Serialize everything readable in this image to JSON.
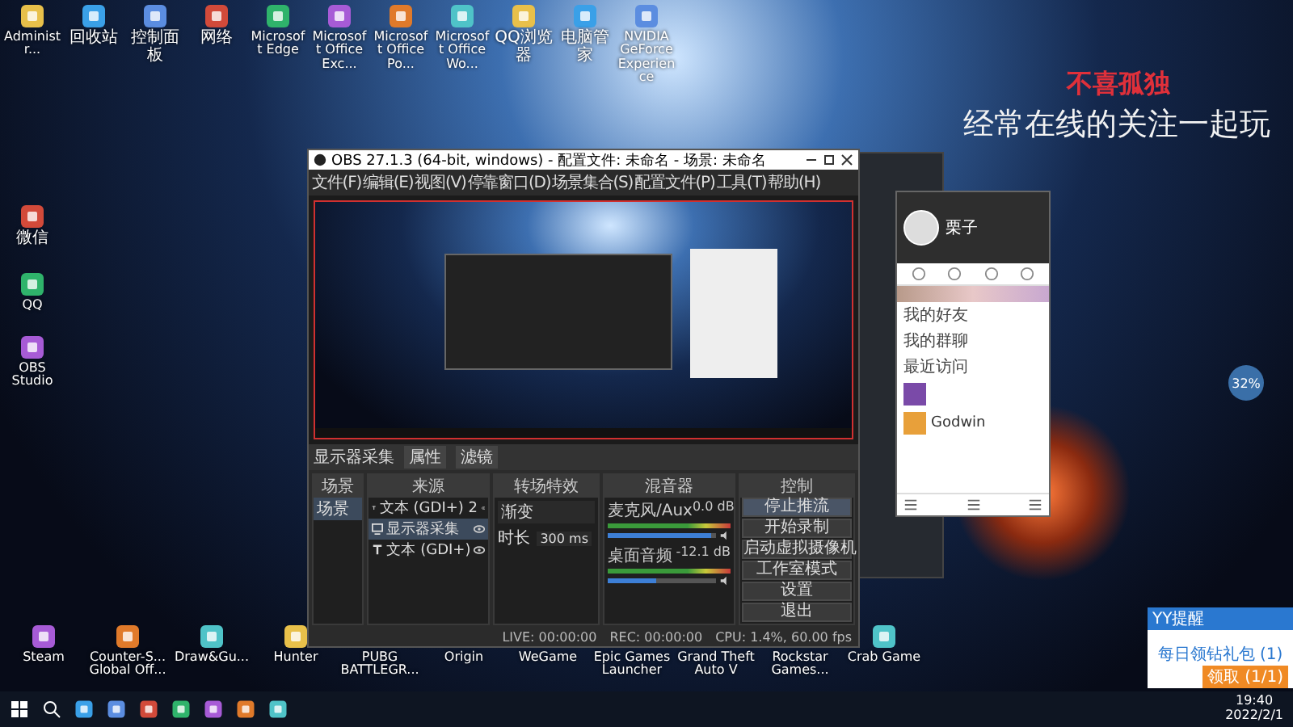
{
  "desktop": {
    "wallpaper_title": "不喜孤独",
    "wallpaper_subtitle": "经常在线的关注一起玩",
    "top_icons": [
      {
        "label": "Administr..."
      },
      {
        "label": "回收站"
      },
      {
        "label": "控制面板"
      },
      {
        "label": "网络"
      },
      {
        "label": "Microsoft Edge"
      },
      {
        "label": "Microsoft Office Exc..."
      },
      {
        "label": "Microsoft Office Po..."
      },
      {
        "label": "Microsoft Office Wo..."
      },
      {
        "label": "QQ浏览器"
      },
      {
        "label": "电脑管家"
      },
      {
        "label": "NVIDIA GeForce Experience"
      }
    ],
    "left_icons": [
      {
        "label": "微信"
      },
      {
        "label": "QQ"
      },
      {
        "label": "OBS Studio"
      }
    ],
    "bottom_icons": [
      {
        "label": "Steam"
      },
      {
        "label": "Counter-S... Global Off..."
      },
      {
        "label": "Draw&Gu..."
      },
      {
        "label": "Hunter"
      },
      {
        "label": "PUBG BATTLEGR..."
      },
      {
        "label": "Origin"
      },
      {
        "label": "WeGame"
      },
      {
        "label": "Epic Games Launcher"
      },
      {
        "label": "Grand Theft Auto V"
      },
      {
        "label": "Rockstar Games..."
      },
      {
        "label": "Crab Game"
      }
    ]
  },
  "obs": {
    "title": "OBS 27.1.3 (64-bit, windows) - 配置文件: 未命名 - 场景: 未命名",
    "menu": [
      "文件(F)",
      "编辑(E)",
      "视图(V)",
      "停靠窗口(D)",
      "场景集合(S)",
      "配置文件(P)",
      "工具(T)",
      "帮助(H)"
    ],
    "context_bar": {
      "source": "显示器采集",
      "buttons": [
        "属性",
        "滤镜"
      ]
    },
    "dock_titles": {
      "scenes": "场景",
      "sources": "来源",
      "transitions": "转场特效",
      "mixer": "混音器",
      "controls": "控制"
    },
    "scenes": [
      {
        "name": "场景",
        "selected": true
      }
    ],
    "sources": [
      {
        "name": "文本 (GDI+) 2",
        "kind": "text",
        "selected": false
      },
      {
        "name": "显示器采集",
        "kind": "display",
        "selected": true
      },
      {
        "name": "文本 (GDI+)",
        "kind": "text",
        "selected": false
      }
    ],
    "transition": {
      "type": "渐变",
      "duration_label": "时长",
      "duration": "300 ms"
    },
    "mixer": [
      {
        "name": "麦克风/Aux",
        "reading": "0.0 dB",
        "level": 0.95
      },
      {
        "name": "桌面音频",
        "reading": "-12.1 dB",
        "level": 0.45
      }
    ],
    "controls": [
      {
        "label": "停止推流",
        "selected": true
      },
      {
        "label": "开始录制",
        "selected": false
      },
      {
        "label": "启动虚拟摄像机",
        "selected": false
      },
      {
        "label": "工作室模式",
        "selected": false
      },
      {
        "label": "设置",
        "selected": false
      },
      {
        "label": "退出",
        "selected": false
      }
    ],
    "status": [
      "LIVE: 00:00:00",
      "REC: 00:00:00",
      "CPU: 1.4%, 60.00 fps"
    ]
  },
  "qq": {
    "name": "栗子",
    "groups": [
      "我的好友",
      "我的群聊",
      "最近访问"
    ],
    "entry": "Godwin"
  },
  "widget": {
    "reading": "32%"
  },
  "notification": {
    "app": "YY提醒",
    "title": "每日领钻礼包 (1)",
    "button": "领取 (1/1)"
  },
  "taskbar": {
    "time": "19:40",
    "date": "2022/2/1"
  }
}
